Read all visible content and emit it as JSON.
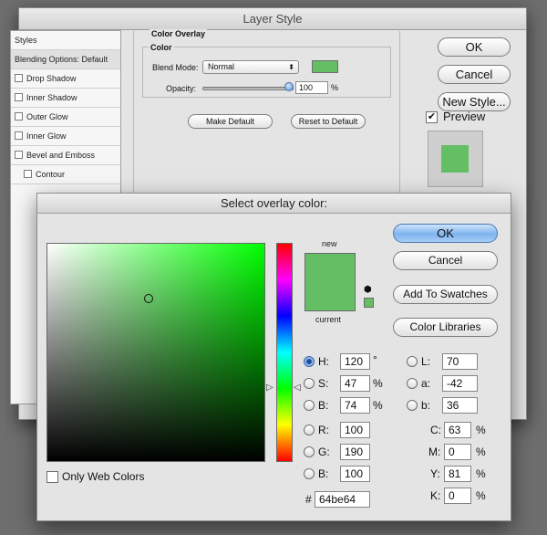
{
  "layer_style": {
    "title": "Layer Style",
    "sidebar": {
      "styles_header": "Styles",
      "blending_options": "Blending Options: Default",
      "items": [
        "Drop Shadow",
        "Inner Shadow",
        "Outer Glow",
        "Inner Glow",
        "Bevel and Emboss",
        "Contour"
      ]
    },
    "color_overlay_title": "Color Overlay",
    "color_group_title": "Color",
    "blend_mode_label": "Blend Mode:",
    "blend_mode_value": "Normal",
    "opacity_label": "Opacity:",
    "opacity_value": "100",
    "opacity_unit": "%",
    "opacity_level": 1.0,
    "make_default": "Make Default",
    "reset_to_default": "Reset to Default",
    "ok": "OK",
    "cancel": "Cancel",
    "new_style": "New Style...",
    "preview_label": "Preview",
    "preview_checked": true,
    "overlay_color": "#64be64"
  },
  "color_picker": {
    "title": "Select overlay color:",
    "new_label": "new",
    "current_label": "current",
    "new_color": "#64be64",
    "current_color": "#64be64",
    "ok": "OK",
    "cancel": "Cancel",
    "add_to_swatches": "Add To Swatches",
    "color_libraries": "Color Libraries",
    "only_web_colors": "Only Web Colors",
    "hsb": {
      "h": {
        "label": "H:",
        "value": "120",
        "unit": "°",
        "selected": true
      },
      "s": {
        "label": "S:",
        "value": "47",
        "unit": "%"
      },
      "b": {
        "label": "B:",
        "value": "74",
        "unit": "%"
      }
    },
    "rgb": {
      "r": {
        "label": "R:",
        "value": "100"
      },
      "g": {
        "label": "G:",
        "value": "190"
      },
      "b": {
        "label": "B:",
        "value": "100"
      }
    },
    "lab": {
      "l": {
        "label": "L:",
        "value": "70"
      },
      "a": {
        "label": "a:",
        "value": "-42"
      },
      "b": {
        "label": "b:",
        "value": "36"
      }
    },
    "cmyk": {
      "c": {
        "label": "C:",
        "value": "63",
        "unit": "%"
      },
      "m": {
        "label": "M:",
        "value": "0",
        "unit": "%"
      },
      "y": {
        "label": "Y:",
        "value": "81",
        "unit": "%"
      },
      "k": {
        "label": "K:",
        "value": "0",
        "unit": "%"
      }
    },
    "hex_label": "#",
    "hex_value": "64be64",
    "field_base_color": "#00ff00",
    "icons": [
      "warning-cube-icon",
      "hue-slider-arrow-icon"
    ]
  }
}
